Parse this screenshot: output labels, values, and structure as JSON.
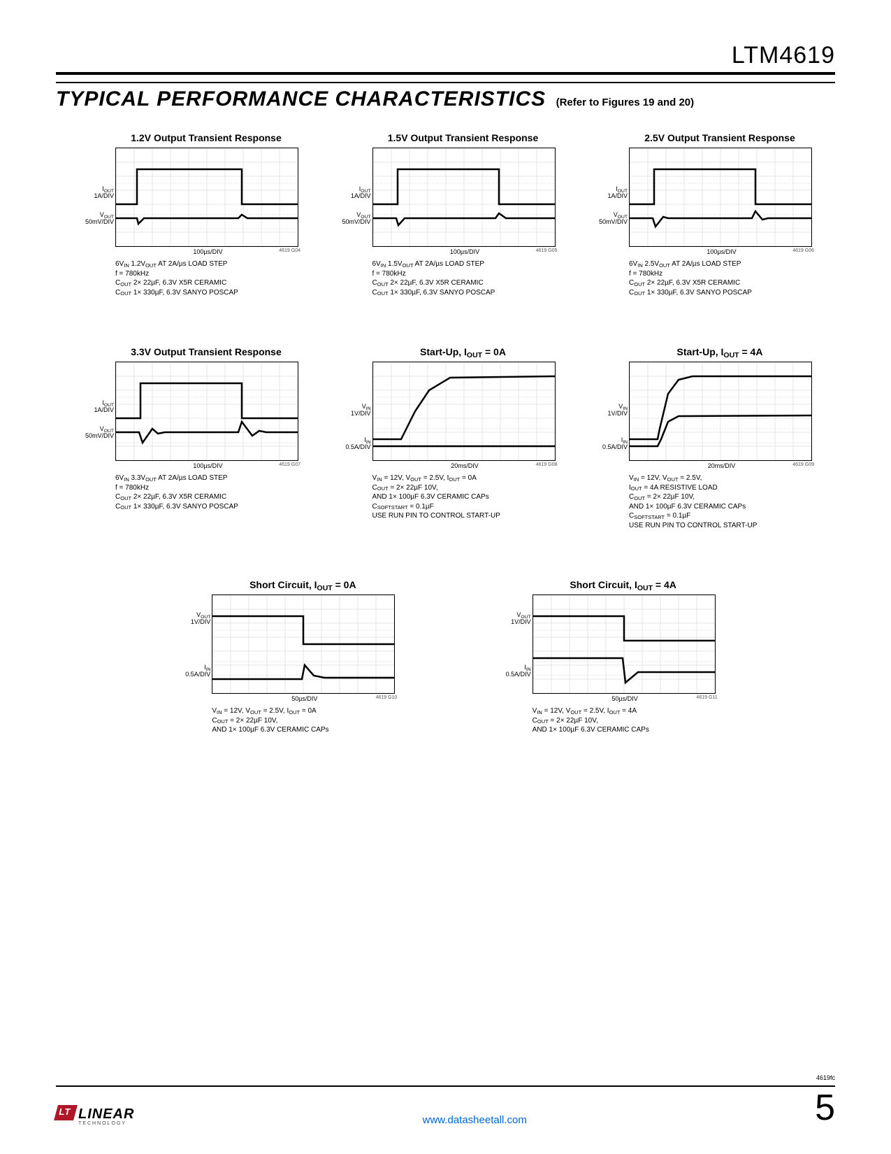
{
  "part_number": "LTM4619",
  "section_title": "TYPICAL PERFORMANCE CHARACTERISTICS",
  "section_subtitle": "(Refer to Figures 19 and 20)",
  "footer": {
    "logo": "LINEAR",
    "logo_sub": "TECHNOLOGY",
    "link": "www.datasheetall.com",
    "page": "5",
    "rev": "4619fc"
  },
  "chart_data": [
    {
      "type": "line",
      "title": "1.2V Output Transient Response",
      "y1_label": "IOUT\n1A/DIV",
      "y2_label": "VOUT\n50mV/DIV",
      "x_label": "100µs/DIV",
      "id": "4619 G04",
      "caption": "6VIN 1.2VOUT AT 2A/µs LOAD STEP\nf = 780kHz\nCOUT 2× 22µF, 6.3V X5R CERAMIC\nCOUT 1× 330µF, 6.3V SANYO POSCAP",
      "trace_type": "transient",
      "series": [
        {
          "name": "IOUT",
          "points": [
            [
              0,
              80
            ],
            [
              30,
              80
            ],
            [
              30,
              30
            ],
            [
              180,
              30
            ],
            [
              180,
              80
            ],
            [
              260,
              80
            ]
          ]
        },
        {
          "name": "VOUT",
          "points": [
            [
              0,
              100
            ],
            [
              30,
              100
            ],
            [
              32,
              108
            ],
            [
              40,
              100
            ],
            [
              175,
              100
            ],
            [
              180,
              95
            ],
            [
              188,
              100
            ],
            [
              260,
              100
            ]
          ]
        }
      ]
    },
    {
      "type": "line",
      "title": "1.5V Output Transient Response",
      "y1_label": "IOUT\n1A/DIV",
      "y2_label": "VOUT\n50mV/DIV",
      "x_label": "100µs/DIV",
      "id": "4619 G05",
      "caption": "6VIN 1.5VOUT AT 2A/µs LOAD STEP\nf = 780kHz\nCOUT 2× 22µF, 6.3V X5R CERAMIC\nCOUT 1× 330µF, 6.3V SANYO POSCAP",
      "trace_type": "transient",
      "series": [
        {
          "name": "IOUT",
          "points": [
            [
              0,
              80
            ],
            [
              35,
              80
            ],
            [
              35,
              30
            ],
            [
              180,
              30
            ],
            [
              180,
              80
            ],
            [
              260,
              80
            ]
          ]
        },
        {
          "name": "VOUT",
          "points": [
            [
              0,
              100
            ],
            [
              33,
              100
            ],
            [
              36,
              110
            ],
            [
              45,
              100
            ],
            [
              175,
              100
            ],
            [
              180,
              93
            ],
            [
              190,
              100
            ],
            [
              260,
              100
            ]
          ]
        }
      ]
    },
    {
      "type": "line",
      "title": "2.5V Output Transient Response",
      "y1_label": "IOUT\n1A/DIV",
      "y2_label": "VOUT\n50mV/DIV",
      "x_label": "100µs/DIV",
      "id": "4619 G06",
      "caption": "6VIN 2.5VOUT AT 2A/µs LOAD STEP\nf = 780kHz\nCOUT 2× 22µF, 6.3V X5R CERAMIC\nCOUT 1× 330µF, 6.3V SANYO POSCAP",
      "trace_type": "transient",
      "series": [
        {
          "name": "IOUT",
          "points": [
            [
              0,
              80
            ],
            [
              35,
              80
            ],
            [
              35,
              30
            ],
            [
              180,
              30
            ],
            [
              180,
              80
            ],
            [
              260,
              80
            ]
          ]
        },
        {
          "name": "VOUT",
          "points": [
            [
              0,
              100
            ],
            [
              33,
              100
            ],
            [
              37,
              112
            ],
            [
              48,
              98
            ],
            [
              55,
              100
            ],
            [
              175,
              100
            ],
            [
              180,
              90
            ],
            [
              190,
              102
            ],
            [
              198,
              100
            ],
            [
              260,
              100
            ]
          ]
        }
      ]
    },
    {
      "type": "line",
      "title": "3.3V Output Transient Response",
      "y1_label": "IOUT\n1A/DIV",
      "y2_label": "VOUT\n50mV/DIV",
      "x_label": "100µs/DIV",
      "id": "4619 G07",
      "caption": "6VIN 3.3VOUT AT 2A/µs LOAD STEP\nf = 780kHz\nCOUT 2× 22µF, 6.3V X5R CERAMIC\nCOUT 1× 330µF, 6.3V SANYO POSCAP",
      "trace_type": "transient",
      "series": [
        {
          "name": "IOUT",
          "points": [
            [
              0,
              80
            ],
            [
              35,
              80
            ],
            [
              35,
              30
            ],
            [
              180,
              30
            ],
            [
              180,
              80
            ],
            [
              260,
              80
            ]
          ]
        },
        {
          "name": "VOUT",
          "points": [
            [
              0,
              100
            ],
            [
              33,
              100
            ],
            [
              38,
              115
            ],
            [
              52,
              95
            ],
            [
              60,
              102
            ],
            [
              70,
              100
            ],
            [
              175,
              100
            ],
            [
              180,
              85
            ],
            [
              195,
              105
            ],
            [
              205,
              98
            ],
            [
              215,
              100
            ],
            [
              260,
              100
            ]
          ]
        }
      ]
    },
    {
      "type": "line",
      "title": "Start-Up, IOUT = 0A",
      "y1_label": "VIN\n1V/DIV",
      "y2_label": "IIN\n0.5A/DIV",
      "x_label": "20ms/DIV",
      "id": "4619 G08",
      "caption": "VIN = 12V, VOUT = 2.5V, IOUT = 0A\nCOUT = 2× 22µF 10V,\nAND 1× 100µF 6.3V CERAMIC CAPs\nCSOFTSTART = 0.1µF\nUSE RUN PIN TO CONTROL START-UP",
      "trace_type": "startup",
      "series": [
        {
          "name": "VIN",
          "points": [
            [
              0,
              110
            ],
            [
              40,
              110
            ],
            [
              45,
              100
            ],
            [
              60,
              70
            ],
            [
              80,
              40
            ],
            [
              110,
              22
            ],
            [
              260,
              20
            ]
          ]
        },
        {
          "name": "IIN",
          "points": [
            [
              0,
              120
            ],
            [
              260,
              120
            ]
          ]
        }
      ]
    },
    {
      "type": "line",
      "title": "Start-Up, IOUT = 4A",
      "y1_label": "VIN\n1V/DIV",
      "y2_label": "IIN\n0.5A/DIV",
      "x_label": "20ms/DIV",
      "id": "4619 G09",
      "caption": "VIN = 12V, VOUT = 2.5V,\nIOUT = 4A RESISTIVE LOAD\nCOUT = 2× 22µF 10V,\nAND 1× 100µF 6.3V CERAMIC CAPs\nCSOFTSTART = 0.1µF\nUSE RUN PIN TO CONTROL START-UP",
      "trace_type": "startup",
      "series": [
        {
          "name": "VIN",
          "points": [
            [
              0,
              110
            ],
            [
              40,
              110
            ],
            [
              43,
              95
            ],
            [
              55,
              45
            ],
            [
              70,
              25
            ],
            [
              90,
              20
            ],
            [
              260,
              20
            ]
          ]
        },
        {
          "name": "IIN",
          "points": [
            [
              0,
              120
            ],
            [
              40,
              120
            ],
            [
              45,
              110
            ],
            [
              55,
              85
            ],
            [
              70,
              77
            ],
            [
              260,
              76
            ]
          ]
        }
      ]
    },
    {
      "type": "line",
      "title": "Short Circuit, IOUT = 0A",
      "y1_label": "VOUT\n1V/DIV",
      "y2_label": "IIN\n0.5A/DIV",
      "x_label": "50µs/DIV",
      "id": "4619 G10",
      "caption": "VIN = 12V, VOUT = 2.5V, IOUT = 0A\nCOUT = 2× 22µF 10V,\nAND 1× 100µF 6.3V CERAMIC CAPs",
      "trace_type": "short",
      "series": [
        {
          "name": "VOUT",
          "points": [
            [
              0,
              30
            ],
            [
              130,
              30
            ],
            [
              130,
              70
            ],
            [
              260,
              70
            ]
          ]
        },
        {
          "name": "IIN",
          "points": [
            [
              0,
              120
            ],
            [
              128,
              120
            ],
            [
              132,
              100
            ],
            [
              145,
              115
            ],
            [
              160,
              118
            ],
            [
              260,
              118
            ]
          ]
        }
      ]
    },
    {
      "type": "line",
      "title": "Short Circuit, IOUT = 4A",
      "y1_label": "VOUT\n1V/DIV",
      "y2_label": "IIN\n0.5A/DIV",
      "x_label": "50µs/DIV",
      "id": "4619 G11",
      "caption": "VIN = 12V, VOUT = 2.5V, IOUT = 4A\nCOUT = 2× 22µF 10V,\nAND 1× 100µF 6.3V CERAMIC CAPs",
      "trace_type": "short",
      "series": [
        {
          "name": "VOUT",
          "points": [
            [
              0,
              30
            ],
            [
              130,
              30
            ],
            [
              130,
              65
            ],
            [
              260,
              65
            ]
          ]
        },
        {
          "name": "IIN",
          "points": [
            [
              0,
              90
            ],
            [
              128,
              90
            ],
            [
              132,
              125
            ],
            [
              150,
              110
            ],
            [
              260,
              110
            ]
          ]
        }
      ]
    }
  ]
}
